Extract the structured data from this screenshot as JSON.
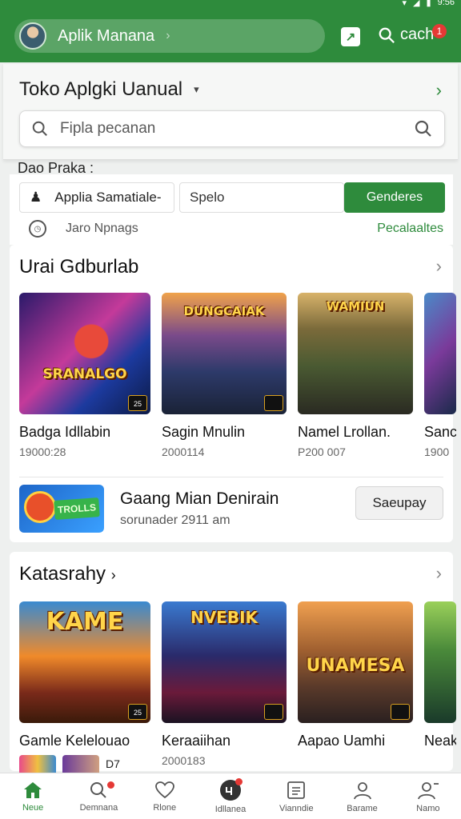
{
  "status": {
    "icons": [
      "wifi-icon",
      "signal-icon",
      "battery-icon"
    ],
    "time": "9:56"
  },
  "header": {
    "app_title": "Aplik Manana",
    "search_label": "cach",
    "notification_count": "1",
    "accent": "#2e8b3c"
  },
  "store": {
    "title": "Toko Aplgki Uanual",
    "search_placeholder": "Fipla pecanan"
  },
  "data_section": {
    "label": "Dao Praka :",
    "app_field": "Applia Samatiale-",
    "speed_field": "Spelo",
    "send_button": "Genderes",
    "sub_text": "Jaro Npnags",
    "sub_link": "Pecalaaltes"
  },
  "section1": {
    "title": "Urai Gdburlab",
    "items": [
      {
        "name": "Badga Idllabin",
        "sub": "19000:28",
        "art": "SRANALGO",
        "badge": "25"
      },
      {
        "name": "Sagin Mnulin",
        "sub": "2000114",
        "art": "DUNGCAIAK",
        "badge": ""
      },
      {
        "name": "Namel Lrollan.",
        "sub": "P200 007",
        "art": "WAMIUN",
        "badge": ""
      },
      {
        "name": "Sanc",
        "sub": "1900",
        "art": "",
        "badge": ""
      }
    ],
    "promo": {
      "title": "Gaang Mian Denirain",
      "sub": "sorunader 2911 am",
      "icon_tag": "TROLLS",
      "button": "Saeupay"
    }
  },
  "section2": {
    "title": "Katasrahy",
    "items": [
      {
        "name": "Gamle Kelelouao",
        "sub": "",
        "art": "KAME",
        "badge": "25"
      },
      {
        "name": "Keraaiihan",
        "sub": "2000183",
        "art": "NVEBIK",
        "badge": ""
      },
      {
        "name": "Aapao Uamhi",
        "sub": "",
        "art": "UNAMESA",
        "badge": ""
      },
      {
        "name": "Neaku",
        "sub": "",
        "art": "",
        "badge": ""
      }
    ],
    "extra_badge": "D7"
  },
  "bottom_nav": [
    {
      "label": "Neue",
      "icon": "home-icon",
      "active": true
    },
    {
      "label": "Demnana",
      "icon": "search-icon",
      "active": false
    },
    {
      "label": "Rlone",
      "icon": "heart-icon",
      "active": false
    },
    {
      "label": "Idllanea",
      "icon": "chat-icon",
      "active": false
    },
    {
      "label": "Vianndie",
      "icon": "document-icon",
      "active": false
    },
    {
      "label": "Barame",
      "icon": "person-icon",
      "active": false
    },
    {
      "label": "Namo",
      "icon": "person-add-icon",
      "active": false
    }
  ]
}
